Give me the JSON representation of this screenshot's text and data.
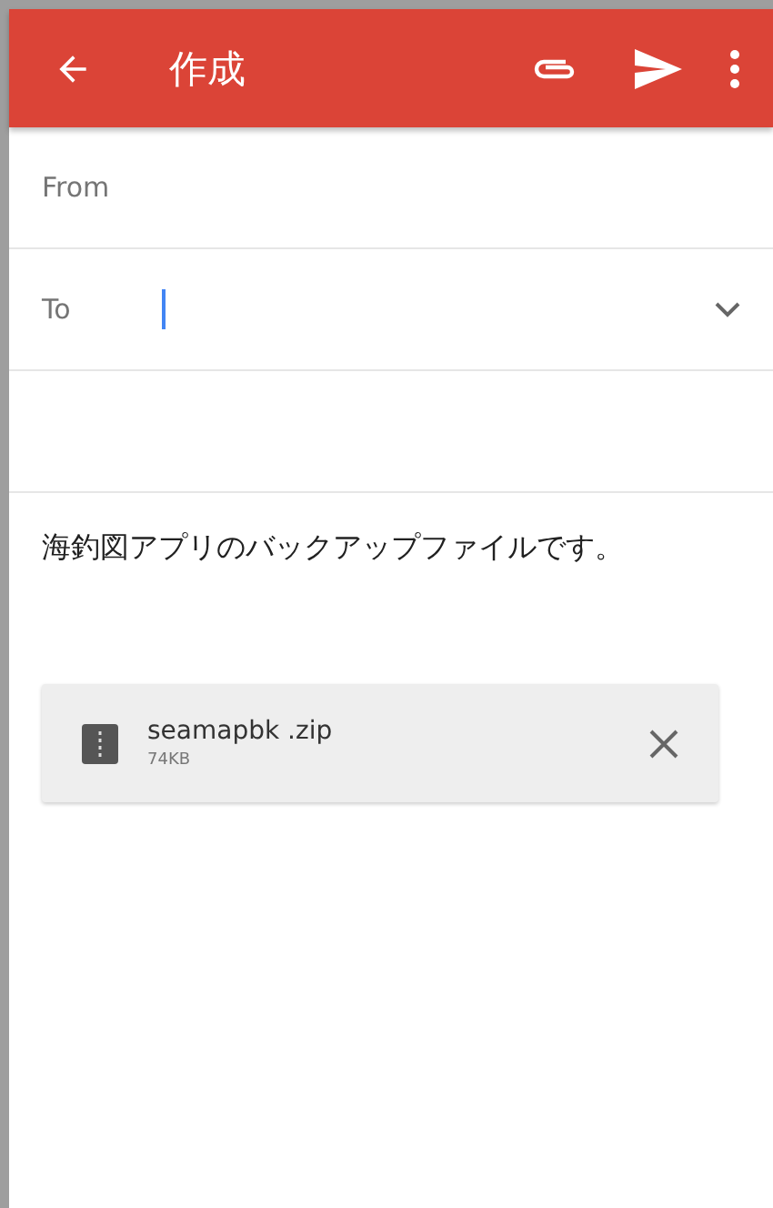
{
  "toolbar": {
    "title": "作成"
  },
  "fields": [
    {
      "kind": "from",
      "label": "From"
    },
    {
      "kind": "to",
      "label": "To",
      "focused": true
    },
    {
      "kind": "subject"
    }
  ],
  "body": "海釣図アプリのバックアップファイルです。",
  "attachment": {
    "name": "seamapbk .zip",
    "size": "74KB"
  }
}
